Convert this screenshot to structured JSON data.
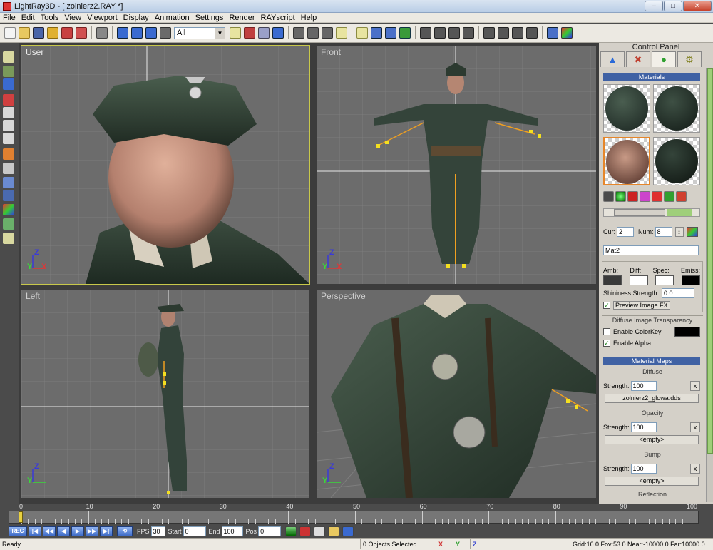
{
  "window": {
    "title": "LightRay3D - [ zolnierz2.RAY *]",
    "buttons": {
      "minimize": "–",
      "maximize": "□",
      "close": "✕"
    }
  },
  "menu": [
    "File",
    "Edit",
    "Tools",
    "View",
    "Viewport",
    "Display",
    "Animation",
    "Settings",
    "Render",
    "RAYscript",
    "Help"
  ],
  "toolbar": {
    "select_value": "All"
  },
  "viewports": {
    "user": {
      "label": "User"
    },
    "front": {
      "label": "Front"
    },
    "left": {
      "label": "Left"
    },
    "perspective": {
      "label": "Perspective"
    },
    "axis": {
      "z": "Z",
      "y": "Y",
      "x": "X"
    }
  },
  "panel": {
    "title": "Control Panel",
    "tabs": [
      "shapes-icon",
      "tools-icon",
      "materials-icon",
      "settings-icon"
    ],
    "materials_header": "Materials",
    "cur_label": "Cur:",
    "cur_value": "2",
    "num_label": "Num:",
    "num_value": "8",
    "material_name": "Mat2",
    "amb_label": "Amb:",
    "diff_label": "Diff:",
    "spec_label": "Spec:",
    "emiss_label": "Emiss:",
    "shininess_label": "Shininess Strength:",
    "shininess_value": "0.0",
    "preview_fx_label": "Preview Image FX",
    "transparency_title": "Diffuse Image Transparency",
    "enable_colorkey_label": "Enable ColorKey",
    "enable_alpha_label": "Enable Alpha",
    "maps_header": "Material Maps",
    "diffuse": {
      "title": "Diffuse",
      "strength_label": "Strength:",
      "strength_value": "100",
      "file": "zolnierz2_glowa.dds"
    },
    "opacity": {
      "title": "Opacity",
      "strength_label": "Strength:",
      "strength_value": "100",
      "file": "<empty>"
    },
    "bump": {
      "title": "Bump",
      "strength_label": "Strength:",
      "strength_value": "100",
      "file": "<empty>"
    },
    "reflection": {
      "title": "Reflection"
    },
    "x_label": "x",
    "colors": {
      "amb": "#3a3a3a",
      "diff": "#ffffff",
      "spec": "#ffffff",
      "emiss": "#000000",
      "colorkey": "#000000"
    }
  },
  "timeline": {
    "ticks": [
      "0",
      "10",
      "20",
      "30",
      "40",
      "50",
      "60",
      "70",
      "80",
      "90",
      "100"
    ]
  },
  "playback": {
    "rec": "REC",
    "fps_label": "FPS",
    "fps_value": "30",
    "start_label": "Start",
    "start_value": "0",
    "end_label": "End",
    "end_value": "100",
    "pos_label": "Pos",
    "pos_value": "0"
  },
  "status": {
    "ready": "Ready",
    "selected": "0 Objects Selected",
    "axis_x": "X",
    "axis_y": "Y",
    "axis_z": "Z",
    "info": "Grid:16.0 Fov:53.0 Near:-10000.0 Far:10000.0"
  }
}
